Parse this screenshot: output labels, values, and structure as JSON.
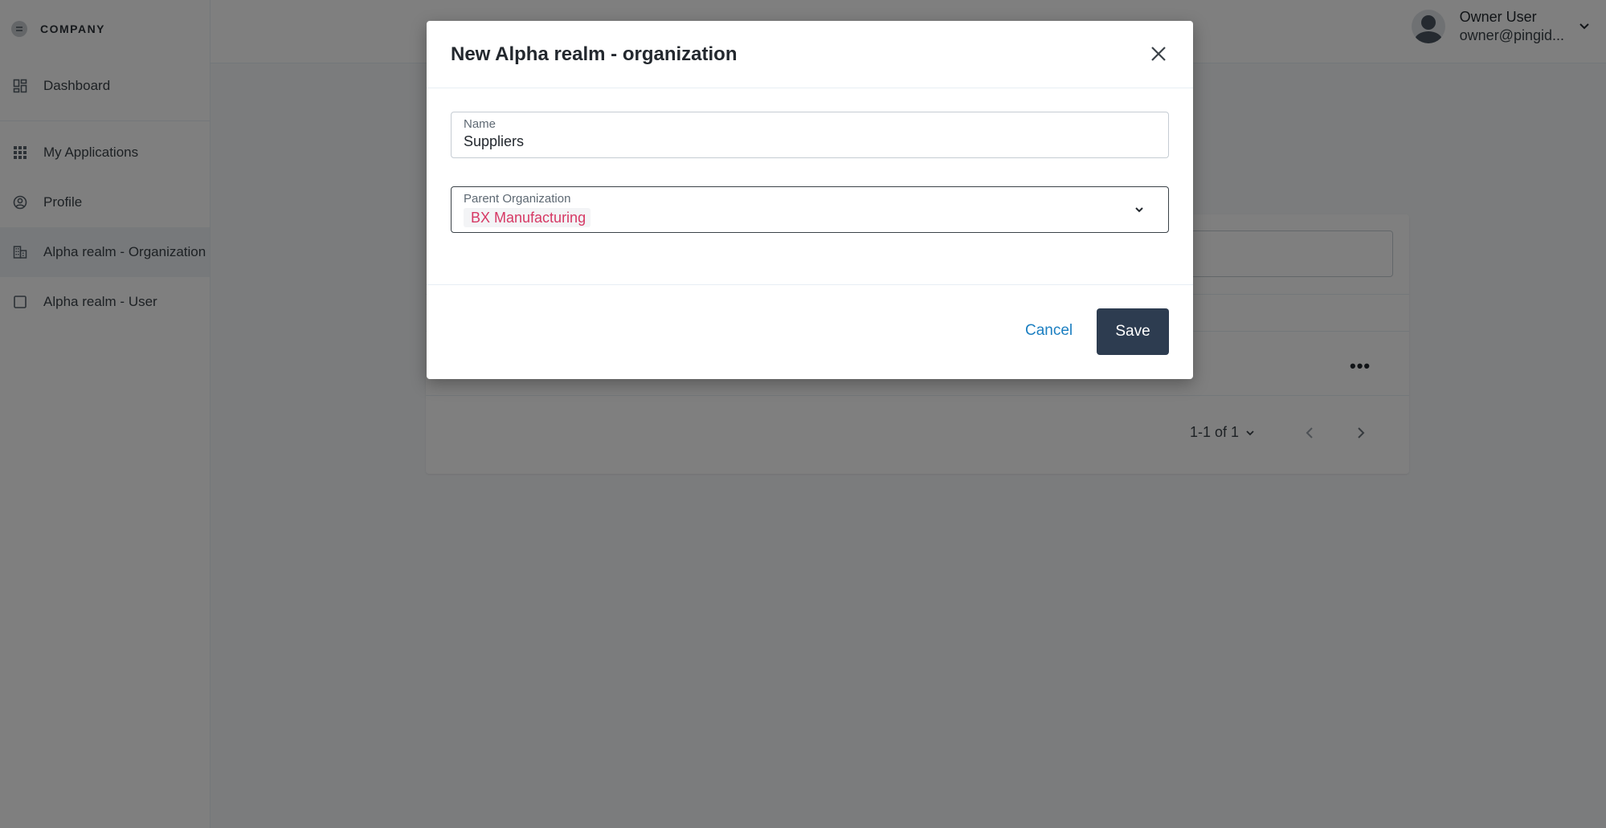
{
  "brand": {
    "name": "COMPANY"
  },
  "sidebar": {
    "items": [
      {
        "label": "Dashboard",
        "icon": "dashboard-icon"
      },
      {
        "label": "My Applications",
        "icon": "apps-grid-icon"
      },
      {
        "label": "Profile",
        "icon": "user-circle-icon"
      },
      {
        "label": "Alpha realm - Organization",
        "icon": "building-icon"
      },
      {
        "label": "Alpha realm - User",
        "icon": "square-icon"
      }
    ]
  },
  "header": {
    "user_name": "Owner User",
    "user_email": "owner@pingid..."
  },
  "background_table": {
    "pagination": "1-1 of 1"
  },
  "modal": {
    "title": "New Alpha realm - organization",
    "name_field": {
      "label": "Name",
      "value": "Suppliers"
    },
    "parent_field": {
      "label": "Parent Organization",
      "value": "BX Manufacturing"
    },
    "cancel_label": "Cancel",
    "save_label": "Save"
  },
  "colors": {
    "primary_button": "#2d3c50",
    "link": "#1c7fc1",
    "chip_text": "#d63864"
  }
}
